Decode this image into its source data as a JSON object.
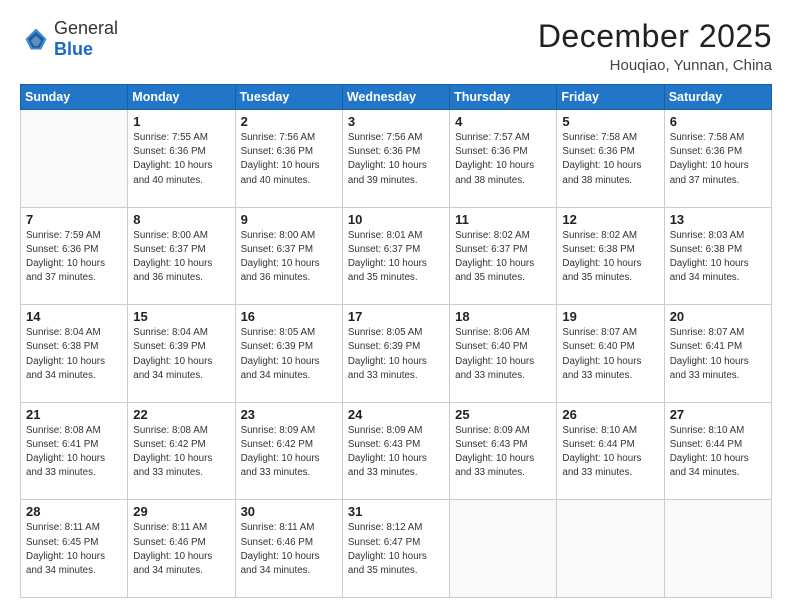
{
  "header": {
    "logo_general": "General",
    "logo_blue": "Blue",
    "month_title": "December 2025",
    "location": "Houqiao, Yunnan, China"
  },
  "weekdays": [
    "Sunday",
    "Monday",
    "Tuesday",
    "Wednesday",
    "Thursday",
    "Friday",
    "Saturday"
  ],
  "weeks": [
    [
      {
        "day": "",
        "info": ""
      },
      {
        "day": "1",
        "info": "Sunrise: 7:55 AM\nSunset: 6:36 PM\nDaylight: 10 hours\nand 40 minutes."
      },
      {
        "day": "2",
        "info": "Sunrise: 7:56 AM\nSunset: 6:36 PM\nDaylight: 10 hours\nand 40 minutes."
      },
      {
        "day": "3",
        "info": "Sunrise: 7:56 AM\nSunset: 6:36 PM\nDaylight: 10 hours\nand 39 minutes."
      },
      {
        "day": "4",
        "info": "Sunrise: 7:57 AM\nSunset: 6:36 PM\nDaylight: 10 hours\nand 38 minutes."
      },
      {
        "day": "5",
        "info": "Sunrise: 7:58 AM\nSunset: 6:36 PM\nDaylight: 10 hours\nand 38 minutes."
      },
      {
        "day": "6",
        "info": "Sunrise: 7:58 AM\nSunset: 6:36 PM\nDaylight: 10 hours\nand 37 minutes."
      }
    ],
    [
      {
        "day": "7",
        "info": "Sunrise: 7:59 AM\nSunset: 6:36 PM\nDaylight: 10 hours\nand 37 minutes."
      },
      {
        "day": "8",
        "info": "Sunrise: 8:00 AM\nSunset: 6:37 PM\nDaylight: 10 hours\nand 36 minutes."
      },
      {
        "day": "9",
        "info": "Sunrise: 8:00 AM\nSunset: 6:37 PM\nDaylight: 10 hours\nand 36 minutes."
      },
      {
        "day": "10",
        "info": "Sunrise: 8:01 AM\nSunset: 6:37 PM\nDaylight: 10 hours\nand 35 minutes."
      },
      {
        "day": "11",
        "info": "Sunrise: 8:02 AM\nSunset: 6:37 PM\nDaylight: 10 hours\nand 35 minutes."
      },
      {
        "day": "12",
        "info": "Sunrise: 8:02 AM\nSunset: 6:38 PM\nDaylight: 10 hours\nand 35 minutes."
      },
      {
        "day": "13",
        "info": "Sunrise: 8:03 AM\nSunset: 6:38 PM\nDaylight: 10 hours\nand 34 minutes."
      }
    ],
    [
      {
        "day": "14",
        "info": "Sunrise: 8:04 AM\nSunset: 6:38 PM\nDaylight: 10 hours\nand 34 minutes."
      },
      {
        "day": "15",
        "info": "Sunrise: 8:04 AM\nSunset: 6:39 PM\nDaylight: 10 hours\nand 34 minutes."
      },
      {
        "day": "16",
        "info": "Sunrise: 8:05 AM\nSunset: 6:39 PM\nDaylight: 10 hours\nand 34 minutes."
      },
      {
        "day": "17",
        "info": "Sunrise: 8:05 AM\nSunset: 6:39 PM\nDaylight: 10 hours\nand 33 minutes."
      },
      {
        "day": "18",
        "info": "Sunrise: 8:06 AM\nSunset: 6:40 PM\nDaylight: 10 hours\nand 33 minutes."
      },
      {
        "day": "19",
        "info": "Sunrise: 8:07 AM\nSunset: 6:40 PM\nDaylight: 10 hours\nand 33 minutes."
      },
      {
        "day": "20",
        "info": "Sunrise: 8:07 AM\nSunset: 6:41 PM\nDaylight: 10 hours\nand 33 minutes."
      }
    ],
    [
      {
        "day": "21",
        "info": "Sunrise: 8:08 AM\nSunset: 6:41 PM\nDaylight: 10 hours\nand 33 minutes."
      },
      {
        "day": "22",
        "info": "Sunrise: 8:08 AM\nSunset: 6:42 PM\nDaylight: 10 hours\nand 33 minutes."
      },
      {
        "day": "23",
        "info": "Sunrise: 8:09 AM\nSunset: 6:42 PM\nDaylight: 10 hours\nand 33 minutes."
      },
      {
        "day": "24",
        "info": "Sunrise: 8:09 AM\nSunset: 6:43 PM\nDaylight: 10 hours\nand 33 minutes."
      },
      {
        "day": "25",
        "info": "Sunrise: 8:09 AM\nSunset: 6:43 PM\nDaylight: 10 hours\nand 33 minutes."
      },
      {
        "day": "26",
        "info": "Sunrise: 8:10 AM\nSunset: 6:44 PM\nDaylight: 10 hours\nand 33 minutes."
      },
      {
        "day": "27",
        "info": "Sunrise: 8:10 AM\nSunset: 6:44 PM\nDaylight: 10 hours\nand 34 minutes."
      }
    ],
    [
      {
        "day": "28",
        "info": "Sunrise: 8:11 AM\nSunset: 6:45 PM\nDaylight: 10 hours\nand 34 minutes."
      },
      {
        "day": "29",
        "info": "Sunrise: 8:11 AM\nSunset: 6:46 PM\nDaylight: 10 hours\nand 34 minutes."
      },
      {
        "day": "30",
        "info": "Sunrise: 8:11 AM\nSunset: 6:46 PM\nDaylight: 10 hours\nand 34 minutes."
      },
      {
        "day": "31",
        "info": "Sunrise: 8:12 AM\nSunset: 6:47 PM\nDaylight: 10 hours\nand 35 minutes."
      },
      {
        "day": "",
        "info": ""
      },
      {
        "day": "",
        "info": ""
      },
      {
        "day": "",
        "info": ""
      }
    ]
  ]
}
